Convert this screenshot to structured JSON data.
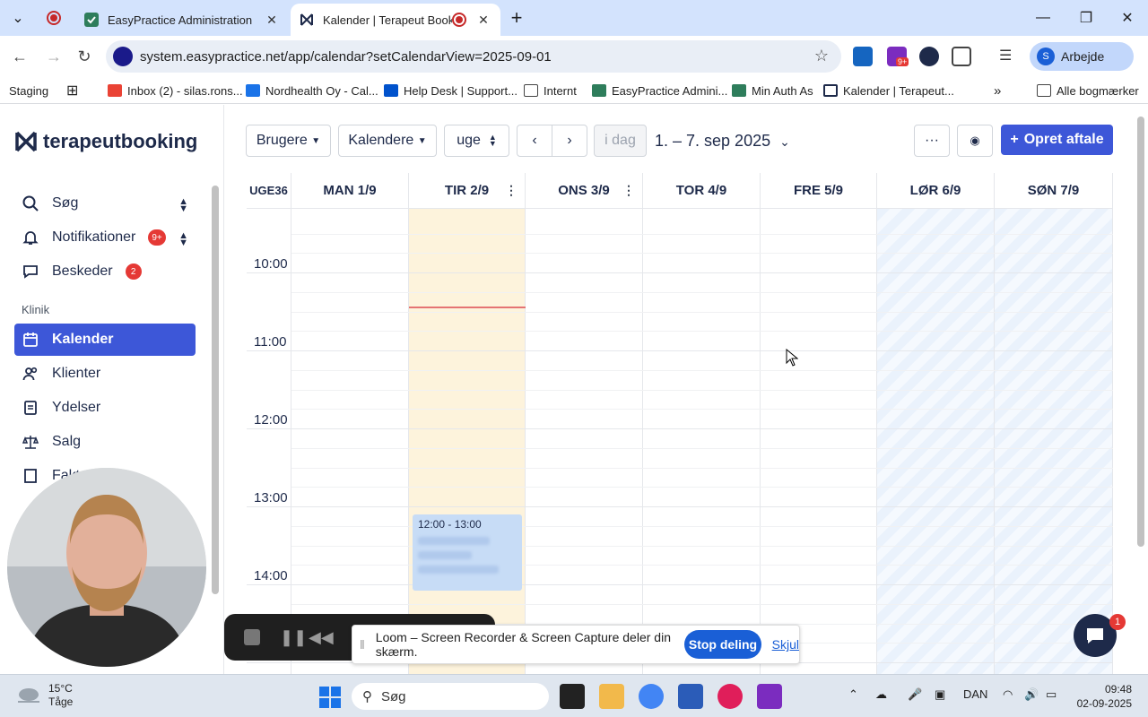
{
  "browser": {
    "tabs": [
      {
        "title": "EasyPractice Administration"
      },
      {
        "title": "Kalender | Terapeut Booking"
      }
    ],
    "url": "system.easypractice.net/app/calendar?setCalendarView=2025-09-01",
    "ext_badge": "9+",
    "profile_initial": "S",
    "profile_label": "Arbejde",
    "bookmarks": [
      "Inbox (2) - silas.rons...",
      "Nordhealth Oy - Cal...",
      "Help Desk | Support...",
      "Internt",
      "EasyPractice Admini...",
      "Min Auth As",
      "Kalender | Terapeut..."
    ],
    "staging_label": "Staging",
    "all_bookmarks": "Alle bogmærker"
  },
  "app": {
    "logo_text": "terapeutbooking",
    "sidebar": {
      "search": "Søg",
      "notifications": "Notifikationer",
      "notifications_badge": "9+",
      "messages": "Beskeder",
      "messages_badge": "2",
      "section_label": "Klinik",
      "items": [
        "Kalender",
        "Klienter",
        "Ydelser",
        "Salg",
        "Fakt"
      ]
    },
    "header": {
      "users": "Brugere",
      "calendars": "Kalendere",
      "view": "uge",
      "today": "i dag",
      "range": "1. – 7. sep 2025",
      "create": "Opret aftale"
    },
    "calendar": {
      "week_label": "UGE36",
      "days": [
        "MAN 1/9",
        "TIR 2/9",
        "ONS 3/9",
        "TOR 4/9",
        "FRE 5/9",
        "LØR 6/9",
        "SØN 7/9"
      ],
      "times": [
        "10:00",
        "11:00",
        "12:00",
        "13:00",
        "14:00"
      ],
      "event_time": "12:00 - 13:00"
    },
    "chat_badge": "1"
  },
  "overlay": {
    "share_text": "Loom – Screen Recorder & Screen Capture deler din skærm.",
    "stop_label": "Stop deling",
    "hide_label": "Skjul"
  },
  "taskbar": {
    "temp": "15°C",
    "weather": "Tåge",
    "search": "Søg",
    "lang": "DAN",
    "time": "09:48",
    "date": "02-09-2025"
  },
  "colors": {
    "accent": "#3d57d8",
    "today_bg": "#fdf3dc",
    "event_bg": "#c7dcf6",
    "now_line": "#e57373"
  }
}
